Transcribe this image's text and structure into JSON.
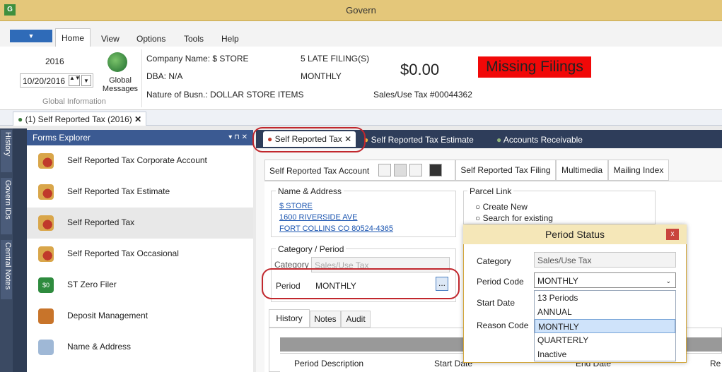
{
  "window": {
    "title": "Govern",
    "app_icon": "G"
  },
  "ribbon_tabs": [
    "Home",
    "View",
    "Options",
    "Tools",
    "Help"
  ],
  "global": {
    "year": "2016",
    "date": "10/20/2016",
    "messages_label": "Global Messages",
    "group_label": "Global Information"
  },
  "account": {
    "company": "Company Name: $ STORE",
    "dba": "DBA: N/A",
    "nature": "Nature of Busn.: DOLLAR STORE ITEMS",
    "late": "5 LATE FILING(S)",
    "frequency": "MONTHLY",
    "amount": "$0.00",
    "tax_no": "Sales/Use Tax #00044362",
    "alert": "Missing Filings"
  },
  "doc_tab": {
    "label": "(1) Self Reported Tax (2016)",
    "close": "✕"
  },
  "rail_tabs": [
    "History",
    "Govern IDs",
    "Central Notes"
  ],
  "forms_explorer": {
    "title": "Forms Explorer",
    "pin": "▾ ⊓ ✕",
    "items": [
      {
        "label": "Self Reported Tax Corporate Account",
        "icon": "search-icon"
      },
      {
        "label": "Self Reported Tax Estimate",
        "icon": "search-icon"
      },
      {
        "label": "Self Reported Tax",
        "icon": "search-icon"
      },
      {
        "label": "Self Reported Tax Occasional",
        "icon": "search-icon"
      },
      {
        "label": "ST Zero Filer",
        "icon": "money-icon"
      },
      {
        "label": "Deposit Management",
        "icon": "deposit-icon"
      },
      {
        "label": "Name & Address",
        "icon": "address-icon"
      }
    ]
  },
  "content_tabs": [
    {
      "label": "Self Reported Tax",
      "close": "✕"
    },
    {
      "label": "Self Reported Tax Estimate"
    },
    {
      "label": "Accounts Receivable"
    }
  ],
  "toolbar": {
    "account_label": "Self Reported Tax Account",
    "tabs": [
      "Self Reported Tax Filing",
      "Multimedia",
      "Mailing Index"
    ]
  },
  "name_address": {
    "legend": "Name & Address",
    "lines": [
      "$ STORE",
      "1600 RIVERSIDE AVE",
      "FORT COLLINS CO  80524-4365"
    ]
  },
  "parcel_link": {
    "legend": "Parcel Link",
    "options": [
      "Create New",
      "Search for existing"
    ]
  },
  "category_period": {
    "legend": "Category / Period",
    "category_label": "Category",
    "category_value": "Sales/Use Tax",
    "period_label": "Period",
    "period_value": "MONTHLY",
    "browse": "..."
  },
  "lower_tabs": [
    "History",
    "Notes",
    "Audit"
  ],
  "grid_headers": [
    "Period Description",
    "Start Date",
    "End Date",
    "Re"
  ],
  "period_dialog": {
    "title": "Period Status",
    "close": "x",
    "category_label": "Category",
    "category_value": "Sales/Use Tax",
    "period_code_label": "Period Code",
    "period_code_value": "MONTHLY",
    "start_date_label": "Start Date",
    "reason_code_label": "Reason Code",
    "options": [
      "13 Periods",
      "ANNUAL",
      "MONTHLY",
      "QUARTERLY",
      "Inactive"
    ],
    "selected": "MONTHLY"
  },
  "colors": {
    "title_bar": "#e4c77a",
    "accent": "#2f6bb8",
    "alert": "#f10808",
    "highlight_ring": "#c1272d"
  }
}
